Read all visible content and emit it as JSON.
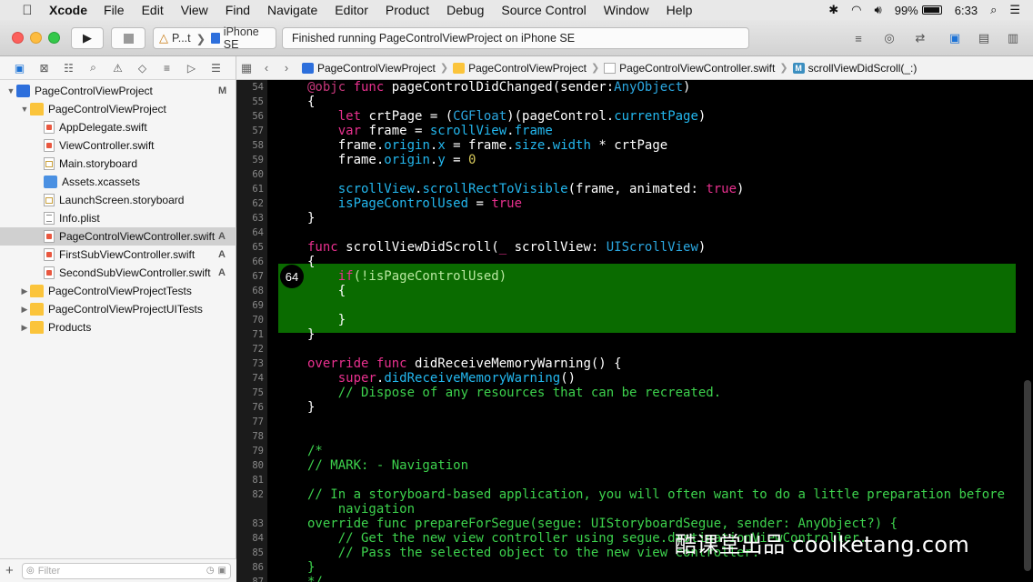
{
  "menubar": {
    "app_name": "Xcode",
    "items": [
      "File",
      "Edit",
      "View",
      "Find",
      "Navigate",
      "Editor",
      "Product",
      "Debug",
      "Source Control",
      "Window",
      "Help"
    ],
    "battery_percent": "99%",
    "time": "6:33"
  },
  "toolbar": {
    "scheme_name": "P...t",
    "destination": "iPhone SE",
    "activity_text": "Finished running PageControlViewProject on iPhone SE"
  },
  "navigator": {
    "filter_placeholder": "Filter",
    "items": [
      {
        "label": "PageControlViewProject",
        "icon": "project-icon",
        "indent": 0,
        "disclosure": "open",
        "badge": "M"
      },
      {
        "label": "PageControlViewProject",
        "icon": "folder-icon",
        "indent": 1,
        "disclosure": "open",
        "badge": ""
      },
      {
        "label": "AppDelegate.swift",
        "icon": "swift-file-icon",
        "indent": 2,
        "disclosure": "",
        "badge": ""
      },
      {
        "label": "ViewController.swift",
        "icon": "swift-file-icon",
        "indent": 2,
        "disclosure": "",
        "badge": ""
      },
      {
        "label": "Main.storyboard",
        "icon": "storyboard-icon",
        "indent": 2,
        "disclosure": "",
        "badge": ""
      },
      {
        "label": "Assets.xcassets",
        "icon": "assets-icon",
        "indent": 2,
        "disclosure": "",
        "badge": ""
      },
      {
        "label": "LaunchScreen.storyboard",
        "icon": "storyboard-icon",
        "indent": 2,
        "disclosure": "",
        "badge": ""
      },
      {
        "label": "Info.plist",
        "icon": "plist-icon",
        "indent": 2,
        "disclosure": "",
        "badge": ""
      },
      {
        "label": "PageControlViewController.swift",
        "icon": "swift-file-icon",
        "indent": 2,
        "disclosure": "",
        "badge": "A",
        "selected": true
      },
      {
        "label": "FirstSubViewController.swift",
        "icon": "swift-file-icon",
        "indent": 2,
        "disclosure": "",
        "badge": "A"
      },
      {
        "label": "SecondSubViewController.swift",
        "icon": "swift-file-icon",
        "indent": 2,
        "disclosure": "",
        "badge": "A"
      },
      {
        "label": "PageControlViewProjectTests",
        "icon": "folder-icon",
        "indent": 1,
        "disclosure": "closed",
        "badge": ""
      },
      {
        "label": "PageControlViewProjectUITests",
        "icon": "folder-icon",
        "indent": 1,
        "disclosure": "closed",
        "badge": ""
      },
      {
        "label": "Products",
        "icon": "folder-icon",
        "indent": 1,
        "disclosure": "closed",
        "badge": ""
      }
    ]
  },
  "jumpbar": {
    "crumbs": [
      {
        "label": "PageControlViewProject",
        "icon": "project-icon"
      },
      {
        "label": "PageControlViewProject",
        "icon": "folder-icon"
      },
      {
        "label": "PageControlViewController.swift",
        "icon": "swift-file-icon"
      },
      {
        "label": "scrollViewDidScroll(_:)",
        "icon": "method-icon",
        "icon_letter": "M"
      }
    ]
  },
  "editor": {
    "fold_badge": "64",
    "watermark": "酷课堂出品 coolketang.com",
    "lines": [
      {
        "n": "54",
        "code": [
          [
            "at",
            "@objc "
          ],
          [
            "kw",
            "func "
          ],
          [
            "",
            "pageControlDidChanged(sender:"
          ],
          [
            "ty",
            "AnyObject"
          ],
          [
            "",
            ")"
          ]
        ]
      },
      {
        "n": "55",
        "code": [
          [
            "",
            "{"
          ]
        ]
      },
      {
        "n": "56",
        "code": [
          [
            "",
            "    "
          ],
          [
            "kw",
            "let "
          ],
          [
            "",
            "crtPage = ("
          ],
          [
            "ty",
            "CGFloat"
          ],
          [
            "",
            ")(pageControl."
          ],
          [
            "fn",
            "currentPage"
          ],
          [
            "",
            ")"
          ]
        ]
      },
      {
        "n": "57",
        "code": [
          [
            "",
            "    "
          ],
          [
            "kw",
            "var "
          ],
          [
            "",
            "frame = "
          ],
          [
            "fn",
            "scrollView"
          ],
          [
            "",
            "."
          ],
          [
            "fn",
            "frame"
          ]
        ]
      },
      {
        "n": "58",
        "code": [
          [
            "",
            "    frame."
          ],
          [
            "fn",
            "origin"
          ],
          [
            "",
            "."
          ],
          [
            "fn",
            "x"
          ],
          [
            "",
            " = frame."
          ],
          [
            "fn",
            "size"
          ],
          [
            "",
            "."
          ],
          [
            "fn",
            "width"
          ],
          [
            "",
            " * crtPage"
          ]
        ]
      },
      {
        "n": "59",
        "code": [
          [
            "",
            "    frame."
          ],
          [
            "fn",
            "origin"
          ],
          [
            "",
            "."
          ],
          [
            "fn",
            "y"
          ],
          [
            "",
            " = "
          ],
          [
            "nm",
            "0"
          ]
        ]
      },
      {
        "n": "60",
        "code": [
          [
            "",
            ""
          ]
        ]
      },
      {
        "n": "61",
        "code": [
          [
            "",
            "    "
          ],
          [
            "fn",
            "scrollView"
          ],
          [
            "",
            "."
          ],
          [
            "fn",
            "scrollRectToVisible"
          ],
          [
            "",
            "(frame, animated: "
          ],
          [
            "kw",
            "true"
          ],
          [
            "",
            ")"
          ]
        ]
      },
      {
        "n": "62",
        "code": [
          [
            "",
            "    "
          ],
          [
            "fn",
            "isPageControlUsed"
          ],
          [
            "",
            " = "
          ],
          [
            "kw",
            "true"
          ]
        ]
      },
      {
        "n": "63",
        "code": [
          [
            "",
            "}"
          ]
        ]
      },
      {
        "n": "64",
        "code": [
          [
            "",
            ""
          ]
        ]
      },
      {
        "n": "65",
        "code": [
          [
            "kw",
            "func "
          ],
          [
            "",
            "scrollViewDidScroll("
          ],
          [
            "kw",
            "_ "
          ],
          [
            "",
            "scrollView: "
          ],
          [
            "ty",
            "UIScrollView"
          ],
          [
            "",
            ")"
          ]
        ]
      },
      {
        "n": "66",
        "code": [
          [
            "",
            "{"
          ]
        ]
      },
      {
        "n": "67",
        "code": [
          [
            "",
            "    "
          ],
          [
            "kw",
            "if"
          ],
          [
            "hl",
            "(!isPageControlUsed)"
          ]
        ]
      },
      {
        "n": "68",
        "code": [
          [
            "",
            "    {"
          ]
        ]
      },
      {
        "n": "69",
        "code": [
          [
            "",
            ""
          ]
        ]
      },
      {
        "n": "70",
        "code": [
          [
            "",
            "    }"
          ]
        ]
      },
      {
        "n": "71",
        "code": [
          [
            "",
            "}"
          ]
        ]
      },
      {
        "n": "72",
        "code": [
          [
            "",
            ""
          ]
        ]
      },
      {
        "n": "73",
        "code": [
          [
            "kw",
            "override "
          ],
          [
            "kw",
            "func "
          ],
          [
            "",
            "didReceiveMemoryWarning() {"
          ]
        ]
      },
      {
        "n": "74",
        "code": [
          [
            "",
            "    "
          ],
          [
            "kw",
            "super"
          ],
          [
            "",
            "."
          ],
          [
            "fn",
            "didReceiveMemoryWarning"
          ],
          [
            "",
            "()"
          ]
        ]
      },
      {
        "n": "75",
        "code": [
          [
            "cm",
            "    // Dispose of any resources that can be recreated."
          ]
        ]
      },
      {
        "n": "76",
        "code": [
          [
            "",
            "}"
          ]
        ]
      },
      {
        "n": "77",
        "code": [
          [
            "",
            ""
          ]
        ]
      },
      {
        "n": "78",
        "code": [
          [
            "",
            ""
          ]
        ]
      },
      {
        "n": "79",
        "code": [
          [
            "cm",
            "/*"
          ]
        ]
      },
      {
        "n": "80",
        "code": [
          [
            "cm",
            "// MARK: - Navigation"
          ]
        ]
      },
      {
        "n": "81",
        "code": [
          [
            "",
            ""
          ]
        ]
      },
      {
        "n": "82",
        "code": [
          [
            "cm",
            "// In a storyboard-based application, you will often want to do a little preparation before"
          ]
        ]
      },
      {
        "n": "",
        "code": [
          [
            "cm",
            "    navigation"
          ]
        ]
      },
      {
        "n": "83",
        "code": [
          [
            "cm",
            "override func prepareForSegue(segue: UIStoryboardSegue, sender: AnyObject?) {"
          ]
        ]
      },
      {
        "n": "84",
        "code": [
          [
            "cm",
            "    // Get the new view controller using segue.destinationViewController."
          ]
        ]
      },
      {
        "n": "85",
        "code": [
          [
            "cm",
            "    // Pass the selected object to the new view controller."
          ]
        ]
      },
      {
        "n": "86",
        "code": [
          [
            "cm",
            "}"
          ]
        ]
      },
      {
        "n": "87",
        "code": [
          [
            "cm",
            "*/"
          ]
        ]
      }
    ]
  }
}
